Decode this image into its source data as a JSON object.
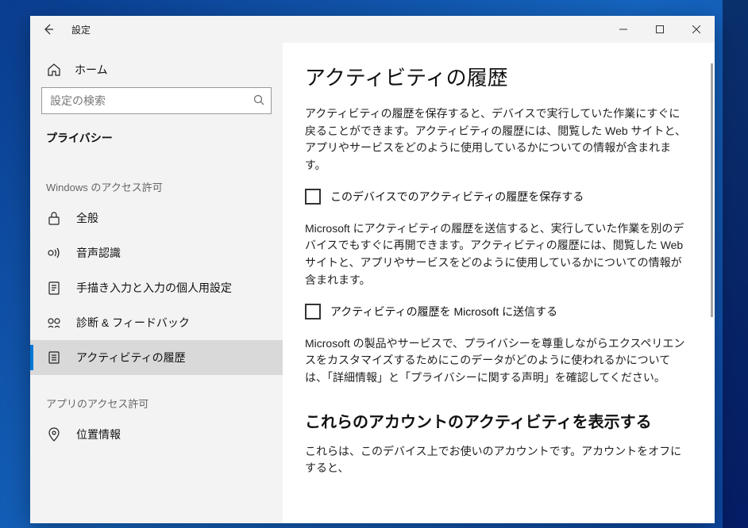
{
  "window": {
    "title": "設定"
  },
  "sidebar": {
    "home": "ホーム",
    "search_placeholder": "設定の検索",
    "category": "プライバシー",
    "section1": "Windows のアクセス許可",
    "section2": "アプリのアクセス許可",
    "items": [
      {
        "label": "全般"
      },
      {
        "label": "音声認識"
      },
      {
        "label": "手描き入力と入力の個人用設定"
      },
      {
        "label": "診断 & フィードバック"
      },
      {
        "label": "アクティビティの履歴"
      }
    ],
    "app_items": [
      {
        "label": "位置情報"
      }
    ]
  },
  "content": {
    "title": "アクティビティの履歴",
    "para1": "アクティビティの履歴を保存すると、デバイスで実行していた作業にすぐに戻ることができます。アクティビティの履歴には、閲覧した Web サイトと、アプリやサービスをどのように使用しているかについての情報が含まれます。",
    "check1": "このデバイスでのアクティビティの履歴を保存する",
    "para2": "Microsoft にアクティビティの履歴を送信すると、実行していた作業を別のデバイスでもすぐに再開できます。アクティビティの履歴には、閲覧した Web サイトと、アプリやサービスをどのように使用しているかについての情報が含まれます。",
    "check2": "アクティビティの履歴を Microsoft に送信する",
    "para3": "Microsoft の製品やサービスで、プライバシーを尊重しながらエクスペリエンスをカスタマイズするためにこのデータがどのように使われるかについては、「詳細情報」と「プライバシーに関する声明」を確認してください。",
    "h2": "これらのアカウントのアクティビティを表示する",
    "para4": "これらは、このデバイス上でお使いのアカウントです。アカウントをオフにすると、"
  }
}
